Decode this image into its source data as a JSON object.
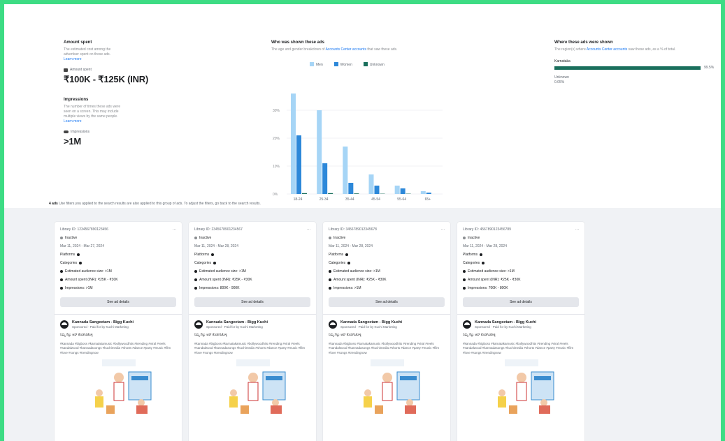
{
  "spend": {
    "title": "Amount spent",
    "desc_1": "The estimated cost among the",
    "desc_2": "advertiser spent on these ads.",
    "link": "Learn more",
    "metric_label": "Amount spent",
    "value": "₹100K - ₹125K (INR)"
  },
  "impressions": {
    "title": "Impressions",
    "desc_1": "The number of times these ads were",
    "desc_2": "seen on a screen. This may include",
    "desc_3": "multiple views by the same people.",
    "link": "Learn more",
    "metric_label": "Impressions",
    "value": ">1M"
  },
  "audience": {
    "title": "Who was shown these ads",
    "desc_prefix": "The age and gender breakdown of",
    "desc_link": "Accounts Center accounts",
    "desc_suffix": "that saw these ads."
  },
  "regions": {
    "title": "Where these ads were shown",
    "desc_prefix": "The region(s) where",
    "desc_link": "Accounts Center accounts",
    "desc_suffix": "saw these ads, as a % of total.",
    "items": [
      {
        "name": "Karnataka",
        "pct": "99.5%",
        "fraction": 0.995
      }
    ],
    "unknown_label": "Unknown",
    "unknown_pct": "0.05%"
  },
  "chart_data": {
    "type": "bar",
    "categories": [
      "18-24",
      "25-34",
      "35-44",
      "45-54",
      "55-64",
      "65+"
    ],
    "series": [
      {
        "name": "Men",
        "color": "#a6d5f6",
        "values": [
          36,
          30,
          17,
          7,
          3,
          1
        ]
      },
      {
        "name": "Women",
        "color": "#2d88d9",
        "values": [
          21,
          11,
          4,
          3,
          2,
          0.5
        ]
      },
      {
        "name": "Unknown",
        "color": "#1a6f5c",
        "values": [
          0.3,
          0.3,
          0.2,
          0.1,
          0.1,
          0
        ]
      }
    ],
    "yticks": [
      "0%",
      "10%",
      "20%",
      "30%"
    ],
    "ylim": [
      0,
      40
    ],
    "grid": true,
    "legend": "top"
  },
  "info": {
    "count": "4 ads",
    "text": "Use filters you applied to the search results are also applied to this group of ads. To adjust the filters, go back to the search results."
  },
  "cards": [
    {
      "library_id": "Library ID: 1234567890123456",
      "status": "Inactive",
      "dates": "Mar 11, 2024 - Mar 27, 2024",
      "platforms": "Platforms",
      "categories": "Categories",
      "audience": "Estimated audience size: >1M",
      "spent": "Amount spent (INR): ₹25K - ₹30K",
      "impressions": "Impressions: >1M",
      "button": "See ad details",
      "advertiser": "Kannada Sangeetam - Bigg Kuchi",
      "sponsored": "Sponsored · Paid for by Kuchi Marketing",
      "headline": "ನಿಮ್ಮ ಗೆಲ್ಲು ಆಪ್ ತೊಡಗಿಸಿಕೊಳ್ಳಿ",
      "body": "#kannada #bigboss #karnatakamusic #bollywoodhits #trending #viral #reels #sandalwood #kannadasongs #kuchimedia #shorts #dance #party #music #film #love #songs #trendingnow"
    },
    {
      "library_id": "Library ID: 2345678901234567",
      "status": "Inactive",
      "dates": "Mar 11, 2024 - Mar 28, 2024",
      "platforms": "Platforms",
      "categories": "Categories",
      "audience": "Estimated audience size: >1M",
      "spent": "Amount spent (INR): ₹25K - ₹30K",
      "impressions": "Impressions: 800K - 900K",
      "button": "See ad details",
      "advertiser": "Kannada Sangeetam - Bigg Kuchi",
      "sponsored": "Sponsored · Paid for by Kuchi Marketing",
      "headline": "ನಿಮ್ಮ ಗೆಲ್ಲು ಆಪ್ ತೊಡಗಿಸಿಕೊಳ್ಳಿ",
      "body": "#kannada #bigboss #karnatakamusic #bollywoodhits #trending #viral #reels #sandalwood #kannadasongs #kuchimedia #shorts #dance #party #music #film #love #songs #trendingnow"
    },
    {
      "library_id": "Library ID: 3456789012345678",
      "status": "Inactive",
      "dates": "Mar 11, 2024 - Mar 28, 2024",
      "platforms": "Platforms",
      "categories": "Categories",
      "audience": "Estimated audience size: >1M",
      "spent": "Amount spent (INR): ₹25K - ₹30K",
      "impressions": "Impressions: >1M",
      "button": "See ad details",
      "advertiser": "Kannada Sangeetam - Bigg Kuchi",
      "sponsored": "Sponsored · Paid for by Kuchi Marketing",
      "headline": "ನಿಮ್ಮ ಗೆಲ್ಲು ಆಪ್ ತೊಡಗಿಸಿಕೊಳ್ಳಿ",
      "body": "#kannada #bigboss #karnatakamusic #bollywoodhits #trending #viral #reels #sandalwood #kannadasongs #kuchimedia #shorts #dance #party #music #film #love #songs #trendingnow"
    },
    {
      "library_id": "Library ID: 4567890123456789",
      "status": "Inactive",
      "dates": "Mar 11, 2024 - Mar 28, 2024",
      "platforms": "Platforms",
      "categories": "Categories",
      "audience": "Estimated audience size: >1M",
      "spent": "Amount spent (INR): ₹25K - ₹30K",
      "impressions": "Impressions: 700K - 800K",
      "button": "See ad details",
      "advertiser": "Kannada Sangeetam - Bigg Kuchi",
      "sponsored": "Sponsored · Paid for by Kuchi Marketing",
      "headline": "ನಿಮ್ಮ ಗೆಲ್ಲು ಆಪ್ ತೊಡಗಿಸಿಕೊಳ್ಳಿ",
      "body": "#kannada #bigboss #karnatakamusic #bollywoodhits #trending #viral #reels #sandalwood #kannadasongs #kuchimedia #shorts #dance #party #music #film #love #songs #trendingnow"
    }
  ]
}
